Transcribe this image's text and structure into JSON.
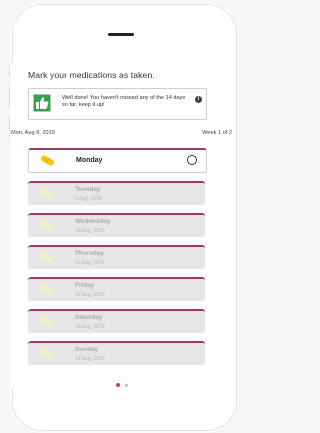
{
  "page": {
    "title": "Mark your medications as taken."
  },
  "notice": {
    "message": "Well done! You haven't missed any of the 14 days so far, keep it up!",
    "info_label": "i"
  },
  "calendar": {
    "current_date": "Mon, Aug 8, 2019",
    "week_label": "Week 1 of 2"
  },
  "days": [
    {
      "name": "Monday",
      "date": "",
      "active": true
    },
    {
      "name": "Tuesday",
      "date": "9 Aug, 2019",
      "active": false
    },
    {
      "name": "Wednesday",
      "date": "10 Aug, 2019",
      "active": false
    },
    {
      "name": "Thursday",
      "date": "11 Aug, 2019",
      "active": false
    },
    {
      "name": "Friday",
      "date": "12 Aug, 2019",
      "active": false
    },
    {
      "name": "Saturday",
      "date": "13 Aug, 2019",
      "active": false
    },
    {
      "name": "Sunday",
      "date": "14 Aug, 2019",
      "active": false
    }
  ],
  "pagination": {
    "pages": 2,
    "current": 1
  },
  "colors": {
    "accent": "#a33868",
    "pill_active": "#f7c400",
    "pill_inactive": "#f5f0c8",
    "thumb": "#3aa050",
    "page_dot_active": "#c23b6f",
    "page_dot_inactive": "#bdbdbd"
  },
  "icons": {
    "notice": "thumbs-up-icon",
    "info": "info-icon",
    "pill": "pill-icon",
    "check": "check-circle-icon"
  }
}
